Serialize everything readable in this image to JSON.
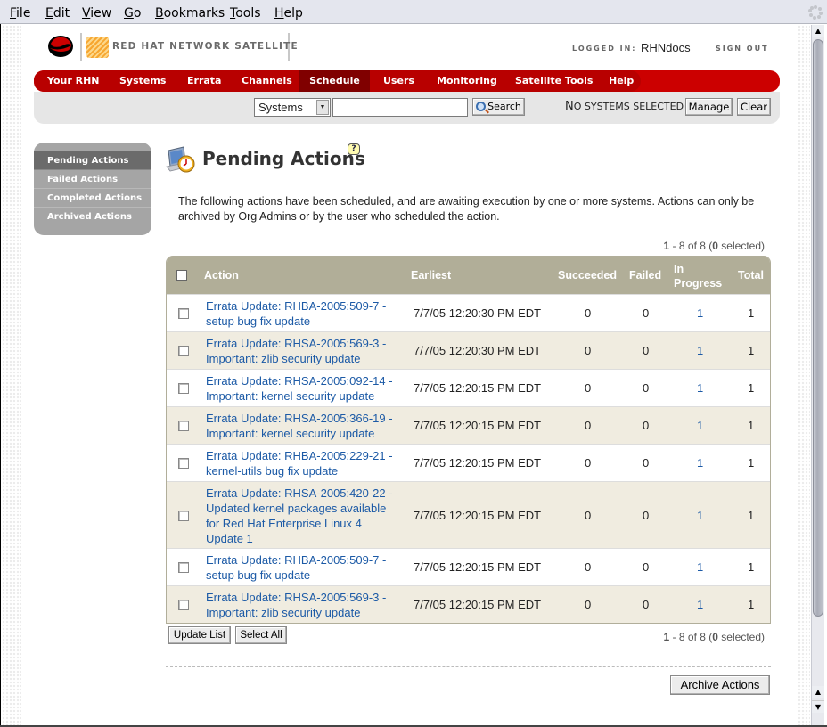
{
  "browser": {
    "menu": [
      {
        "label": "File",
        "accel": "F"
      },
      {
        "label": "Edit",
        "accel": "E"
      },
      {
        "label": "View",
        "accel": "V"
      },
      {
        "label": "Go",
        "accel": "G"
      },
      {
        "label": "Bookmarks",
        "accel": "B"
      },
      {
        "label": "Tools",
        "accel": "T"
      },
      {
        "label": "Help",
        "accel": "H"
      }
    ]
  },
  "header": {
    "logo_text": "RED HAT NETWORK SATELLITE",
    "logged_in_label": "LOGGED IN:",
    "username": "RHNdocs",
    "sign_out": "SIGN OUT"
  },
  "nav": {
    "items": [
      "Your RHN",
      "Systems",
      "Errata",
      "Channels",
      "Schedule",
      "Users",
      "Monitoring",
      "Satellite Tools",
      "Help"
    ],
    "active": "Schedule"
  },
  "toolbar": {
    "search_scope": "Systems",
    "search_value": "",
    "search_button": "Search",
    "systems_status_first": "N",
    "systems_status_rest": "O SYSTEMS SELECTED",
    "manage_button": "Manage",
    "clear_button": "Clear"
  },
  "sidebar": {
    "items": [
      "Pending Actions",
      "Failed Actions",
      "Completed Actions",
      "Archived Actions"
    ],
    "active": "Pending Actions"
  },
  "main": {
    "title": "Pending Actions",
    "help_glyph": "?",
    "intro": "The following actions have been scheduled, and are awaiting execution by one or more systems. Actions can only be archived by Org Admins or by the user who scheduled the action.",
    "pager": {
      "start": "1",
      "end": "8",
      "total": "8",
      "selected": "0"
    },
    "table": {
      "headers": {
        "action": "Action",
        "earliest": "Earliest",
        "succeeded": "Succeeded",
        "failed": "Failed",
        "in_progress_1": "In",
        "in_progress_2": "Progress",
        "total": "Total"
      },
      "rows": [
        {
          "action_1": "Errata Update: RHBA-2005:509-7 -",
          "action_2": "setup bug fix update",
          "action_3": "",
          "action_4": "",
          "earliest": "7/7/05 12:20:30 PM EDT",
          "succeeded": "0",
          "failed": "0",
          "in_progress": "1",
          "total": "1"
        },
        {
          "action_1": "Errata Update: RHSA-2005:569-3 -",
          "action_2": "Important: zlib security update",
          "action_3": "",
          "action_4": "",
          "earliest": "7/7/05 12:20:30 PM EDT",
          "succeeded": "0",
          "failed": "0",
          "in_progress": "1",
          "total": "1"
        },
        {
          "action_1": "Errata Update: RHSA-2005:092-14 -",
          "action_2": "Important: kernel security update",
          "action_3": "",
          "action_4": "",
          "earliest": "7/7/05 12:20:15 PM EDT",
          "succeeded": "0",
          "failed": "0",
          "in_progress": "1",
          "total": "1"
        },
        {
          "action_1": "Errata Update: RHSA-2005:366-19 -",
          "action_2": "Important: kernel security update",
          "action_3": "",
          "action_4": "",
          "earliest": "7/7/05 12:20:15 PM EDT",
          "succeeded": "0",
          "failed": "0",
          "in_progress": "1",
          "total": "1"
        },
        {
          "action_1": "Errata Update: RHBA-2005:229-21 -",
          "action_2": "kernel-utils bug fix update",
          "action_3": "",
          "action_4": "",
          "earliest": "7/7/05 12:20:15 PM EDT",
          "succeeded": "0",
          "failed": "0",
          "in_progress": "1",
          "total": "1"
        },
        {
          "action_1": "Errata Update: RHSA-2005:420-22 -",
          "action_2": "Updated kernel packages available",
          "action_3": "for Red Hat Enterprise Linux 4",
          "action_4": "Update 1",
          "earliest": "7/7/05 12:20:15 PM EDT",
          "succeeded": "0",
          "failed": "0",
          "in_progress": "1",
          "total": "1"
        },
        {
          "action_1": "Errata Update: RHBA-2005:509-7 -",
          "action_2": "setup bug fix update",
          "action_3": "",
          "action_4": "",
          "earliest": "7/7/05 12:20:15 PM EDT",
          "succeeded": "0",
          "failed": "0",
          "in_progress": "1",
          "total": "1"
        },
        {
          "action_1": "Errata Update: RHSA-2005:569-3 -",
          "action_2": "Important: zlib security update",
          "action_3": "",
          "action_4": "",
          "earliest": "7/7/05 12:20:15 PM EDT",
          "succeeded": "0",
          "failed": "0",
          "in_progress": "1",
          "total": "1"
        }
      ]
    },
    "update_list_button": "Update List",
    "select_all_button": "Select All",
    "archive_button": "Archive Actions"
  },
  "colors": {
    "nav_red": "#cc0000",
    "nav_active": "#800000",
    "table_header": "#b1ae98",
    "row_alt": "#f0ece0",
    "link": "#1c5aa6"
  }
}
